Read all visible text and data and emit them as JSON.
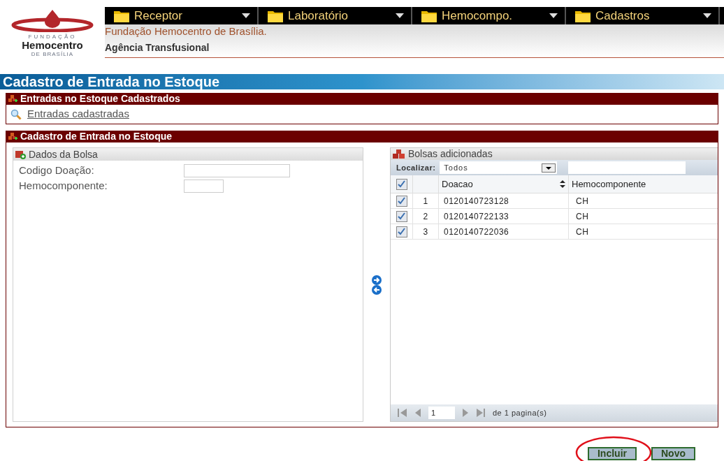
{
  "logo": {
    "top": "FUNDAÇÃO",
    "name": "Hemocentro",
    "bottom": "DE BRASÍLIA"
  },
  "menu": [
    {
      "label": "Receptor"
    },
    {
      "label": "Laboratório"
    },
    {
      "label": "Hemocompo."
    },
    {
      "label": "Cadastros"
    }
  ],
  "header": {
    "organization": "Fundação Hemocentro de Brasília.",
    "unit": "Agência Transfusional"
  },
  "page_title": "Cadastro de Entrada no Estoque",
  "list_section": {
    "title": "Entradas no Estoque Cadastrados",
    "link": "Entradas cadastradas"
  },
  "form_section": {
    "title": "Cadastro de Entrada no Estoque",
    "bag_panel": {
      "title": "Dados da Bolsa",
      "fields": [
        {
          "label": "Codigo Doação:",
          "kind": "wide"
        },
        {
          "label": "Hemocomponente:",
          "kind": "narrow"
        }
      ]
    },
    "grid": {
      "title": "Bolsas adicionadas",
      "filter_label": "Localizar:",
      "filter_value": "Todos",
      "header_checked": true,
      "columns": [
        "Doacao",
        "Hemocomponente"
      ],
      "rows": [
        {
          "number": "1",
          "doacao": "0120140723128",
          "hemocomponente": "CH",
          "checked": true
        },
        {
          "number": "2",
          "doacao": "0120140722133",
          "hemocomponente": "CH",
          "checked": true
        },
        {
          "number": "3",
          "doacao": "0120140722036",
          "hemocomponente": "CH",
          "checked": true
        }
      ],
      "pager": {
        "page": "1",
        "total": "de 1 pagina(s)"
      }
    }
  },
  "buttons": [
    "Incluir",
    "Novo"
  ]
}
